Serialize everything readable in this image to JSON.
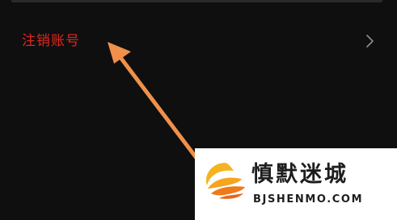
{
  "menu": {
    "items": [
      {
        "label": "注销账号",
        "icon": "chevron-right-icon"
      }
    ]
  },
  "annotation": {
    "icon": "pointer-arrow-icon",
    "color": "#f0904a"
  },
  "watermark": {
    "name": "慎默迷城",
    "domain": "BJSHENMO.COM",
    "icon": "logo-icon",
    "logo_colors": [
      "#f5b321",
      "#e8641b"
    ]
  },
  "colors": {
    "background": "#0f0f10",
    "danger_text": "#e2261f",
    "chevron": "#8c8c8c"
  }
}
